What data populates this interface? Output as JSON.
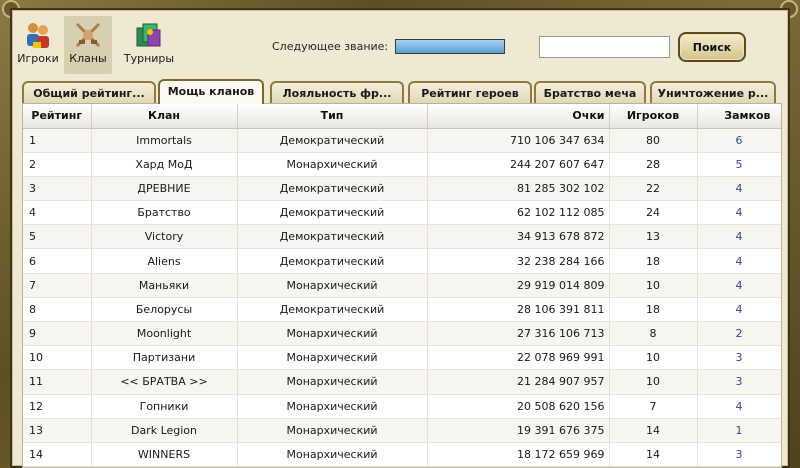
{
  "nav": {
    "players_label": "Игроки",
    "clans_label": "Кланы",
    "tournaments_label": "Турниры"
  },
  "header": {
    "next_rank_label": "Следующее звание:",
    "search_placeholder": "",
    "search_button": "Поиск"
  },
  "tabs": [
    {
      "label": "Общий рейтинг...",
      "active": false
    },
    {
      "label": "Мощь кланов",
      "active": true
    },
    {
      "label": "Лояльность фр...",
      "active": false
    },
    {
      "label": "Рейтинг героев",
      "active": false
    },
    {
      "label": "Братство меча",
      "active": false
    },
    {
      "label": "Уничтожение р...",
      "active": false
    }
  ],
  "table": {
    "columns": [
      "Рейтинг",
      "Клан",
      "Тип",
      "Очки",
      "Игроков",
      "Замков"
    ],
    "rows": [
      [
        "1",
        "Immortals",
        "Демократический",
        "710 106 347 634",
        "80",
        "6"
      ],
      [
        "2",
        "Хард МоД",
        "Монархический",
        "244 207 607 647",
        "28",
        "5"
      ],
      [
        "3",
        "ДРЕВНИЕ",
        "Демократический",
        "81 285 302 102",
        "22",
        "4"
      ],
      [
        "4",
        "Братство",
        "Демократический",
        "62 102 112 085",
        "24",
        "4"
      ],
      [
        "5",
        "Victory",
        "Демократический",
        "34 913 678 872",
        "13",
        "4"
      ],
      [
        "6",
        "Aliens",
        "Демократический",
        "32 238 284 166",
        "18",
        "4"
      ],
      [
        "7",
        "Маньяки",
        "Монархический",
        "29 919 014 809",
        "10",
        "4"
      ],
      [
        "8",
        "Белорусы",
        "Демократический",
        "28 106 391 811",
        "18",
        "4"
      ],
      [
        "9",
        "Moonlight",
        "Монархический",
        "27 316 106 713",
        "8",
        "2"
      ],
      [
        "10",
        "Партизани",
        "Монархический",
        "22 078 969 991",
        "10",
        "3"
      ],
      [
        "11",
        "<< БРАТВА >>",
        "Монархический",
        "21 284 907 957",
        "10",
        "3"
      ],
      [
        "12",
        "Гопники",
        "Монархический",
        "20 508 620 156",
        "7",
        "4"
      ],
      [
        "13",
        "Dark Legion",
        "Монархический",
        "19 391 676 375",
        "14",
        "1"
      ],
      [
        "14",
        "WINNERS",
        "Монархический",
        "18 172 659 969",
        "14",
        "3"
      ]
    ]
  },
  "colors": {
    "frame": "#6b5a2e",
    "panel": "#efe9d4",
    "rank_bar": "#7fb6e6",
    "number_link": "#2c4a8a"
  }
}
